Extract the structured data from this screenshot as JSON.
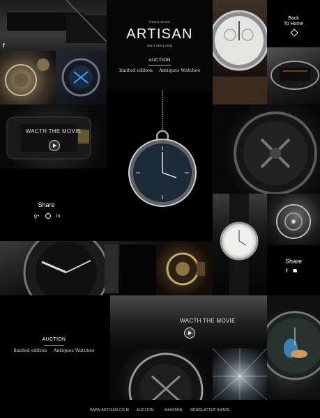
{
  "brand": {
    "top_label": "PRECISION",
    "name": "ARTISAN",
    "sub_label": "SWITZERLAND"
  },
  "top_menu": {
    "heading": "AUCTION",
    "links": [
      "limited edition",
      "Antiques Watches"
    ]
  },
  "back_link": {
    "line1": "Back",
    "line2": "To Home"
  },
  "share_left": {
    "heading": "Share",
    "icons": [
      "g+",
      "pinterest",
      "in"
    ]
  },
  "share_right": {
    "heading": "Share",
    "icons": [
      "f",
      "twitter"
    ]
  },
  "facebook_top": "f",
  "movie_tile_1": {
    "label": "WACTH THE MOVIE"
  },
  "movie_tile_2": {
    "label": "WACTH THE MOVIE"
  },
  "bottom_menu": {
    "heading": "AUCTION",
    "links": [
      "limited edition",
      "Antiques Watches"
    ]
  },
  "footer": {
    "site": "WWW.ARTISAN.CO.M",
    "nav": [
      "AUCTION",
      "MAINTAIN",
      "NEWSLATTER",
      "SHARE"
    ]
  }
}
